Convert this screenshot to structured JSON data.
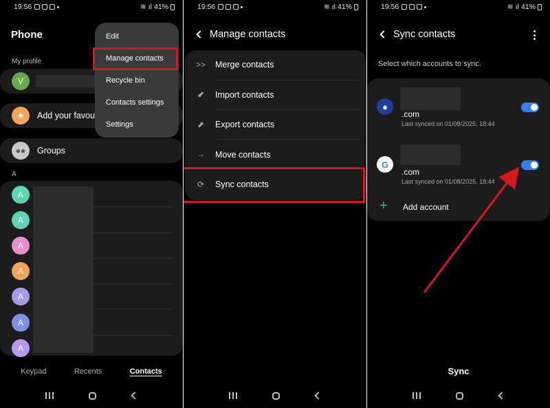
{
  "status_bar": {
    "time": "19:56",
    "battery": "41%"
  },
  "panel1": {
    "title": "Phone",
    "my_profile_label": "My profile",
    "profile_initial": "V",
    "favourites_label": "Add your favour",
    "groups_label": "Groups",
    "section_letter": "A",
    "contact_initial": "A",
    "menu": [
      "Edit",
      "Manage contacts",
      "Recycle bin",
      "Contacts settings",
      "Settings"
    ],
    "tabs": [
      "Keypad",
      "Recents",
      "Contacts"
    ],
    "colors": {
      "avatar_green": "#6aa84f",
      "avatar_teal": "#5fd4b4",
      "avatar_pink": "#e58fd0",
      "avatar_orange": "#f4a35d",
      "avatar_purple": "#a99ae6",
      "avatar_blue": "#7f8fe8",
      "highlight": "#d3181f"
    }
  },
  "panel2": {
    "title": "Manage contacts",
    "items": [
      "Merge contacts",
      "Import contacts",
      "Export contacts",
      "Move contacts",
      "Sync contacts"
    ],
    "icons": [
      "merge-icon",
      "import-icon",
      "export-icon",
      "move-icon",
      "sync-icon"
    ]
  },
  "panel3": {
    "title": "Sync contacts",
    "subtitle": "Select which accounts to sync.",
    "accounts": [
      {
        "domain": ".com",
        "last_synced": "Last synced on 01/08/2025, 18:44",
        "enabled": true,
        "icon": "samsung-account-icon"
      },
      {
        "domain": ".com",
        "last_synced": "Last synced on 01/08/2025, 18:44",
        "enabled": true,
        "icon": "google-icon"
      }
    ],
    "add_account": "Add account",
    "sync_button": "Sync",
    "colors": {
      "toggle_on": "#3b7cf7",
      "add_plus": "#2fbf5f",
      "arrow": "#d3181f"
    }
  }
}
